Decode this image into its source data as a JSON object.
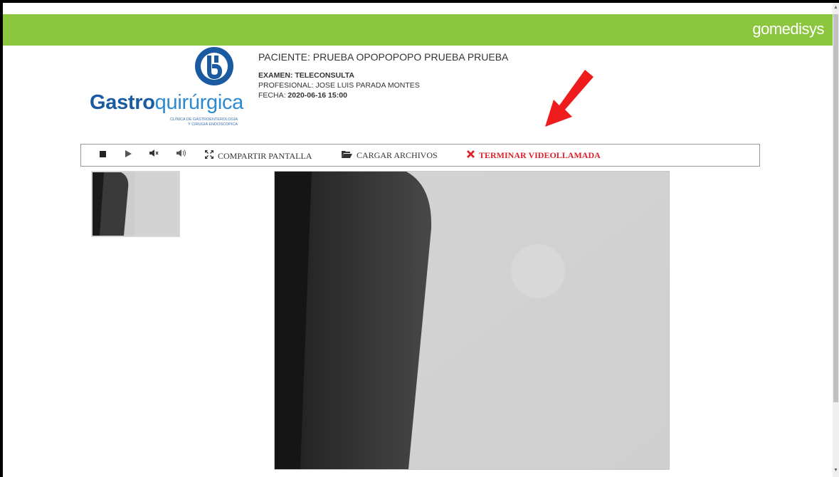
{
  "header": {
    "brand": "gomedisys",
    "bar_color": "#8cc63f"
  },
  "logo": {
    "name_bold": "Gastro",
    "name_light": "quirúrgica",
    "subtitle_line1": "CLÍNICA DE GASTROENTEROLOGÍA",
    "subtitle_line2": "Y CIRUGIA ENDOSCOPICA"
  },
  "patient": {
    "name": "PACIENTE: PRUEBA OPOPOPOPO PRUEBA PRUEBA",
    "exam": "EXAMEN: TELECONSULTA",
    "professional": "PROFESIONAL: JOSE LUIS PARADA MONTES",
    "date_label": "FECHA: ",
    "date_value": "2020-06-16 15:00"
  },
  "toolbar": {
    "stop_icon": "stop-icon",
    "play_icon": "play-icon",
    "mute_icon": "mute-icon",
    "volume_icon": "volume-icon",
    "share_screen_label": "COMPARTIR  PANTALLA",
    "upload_files_label": "CARGAR  ARCHIVOS",
    "end_call_label": "TERMINAR  VIDEOLLAMADA",
    "end_call_color": "#d9222a"
  },
  "annotation": {
    "arrow_color": "#ee1c1c"
  }
}
